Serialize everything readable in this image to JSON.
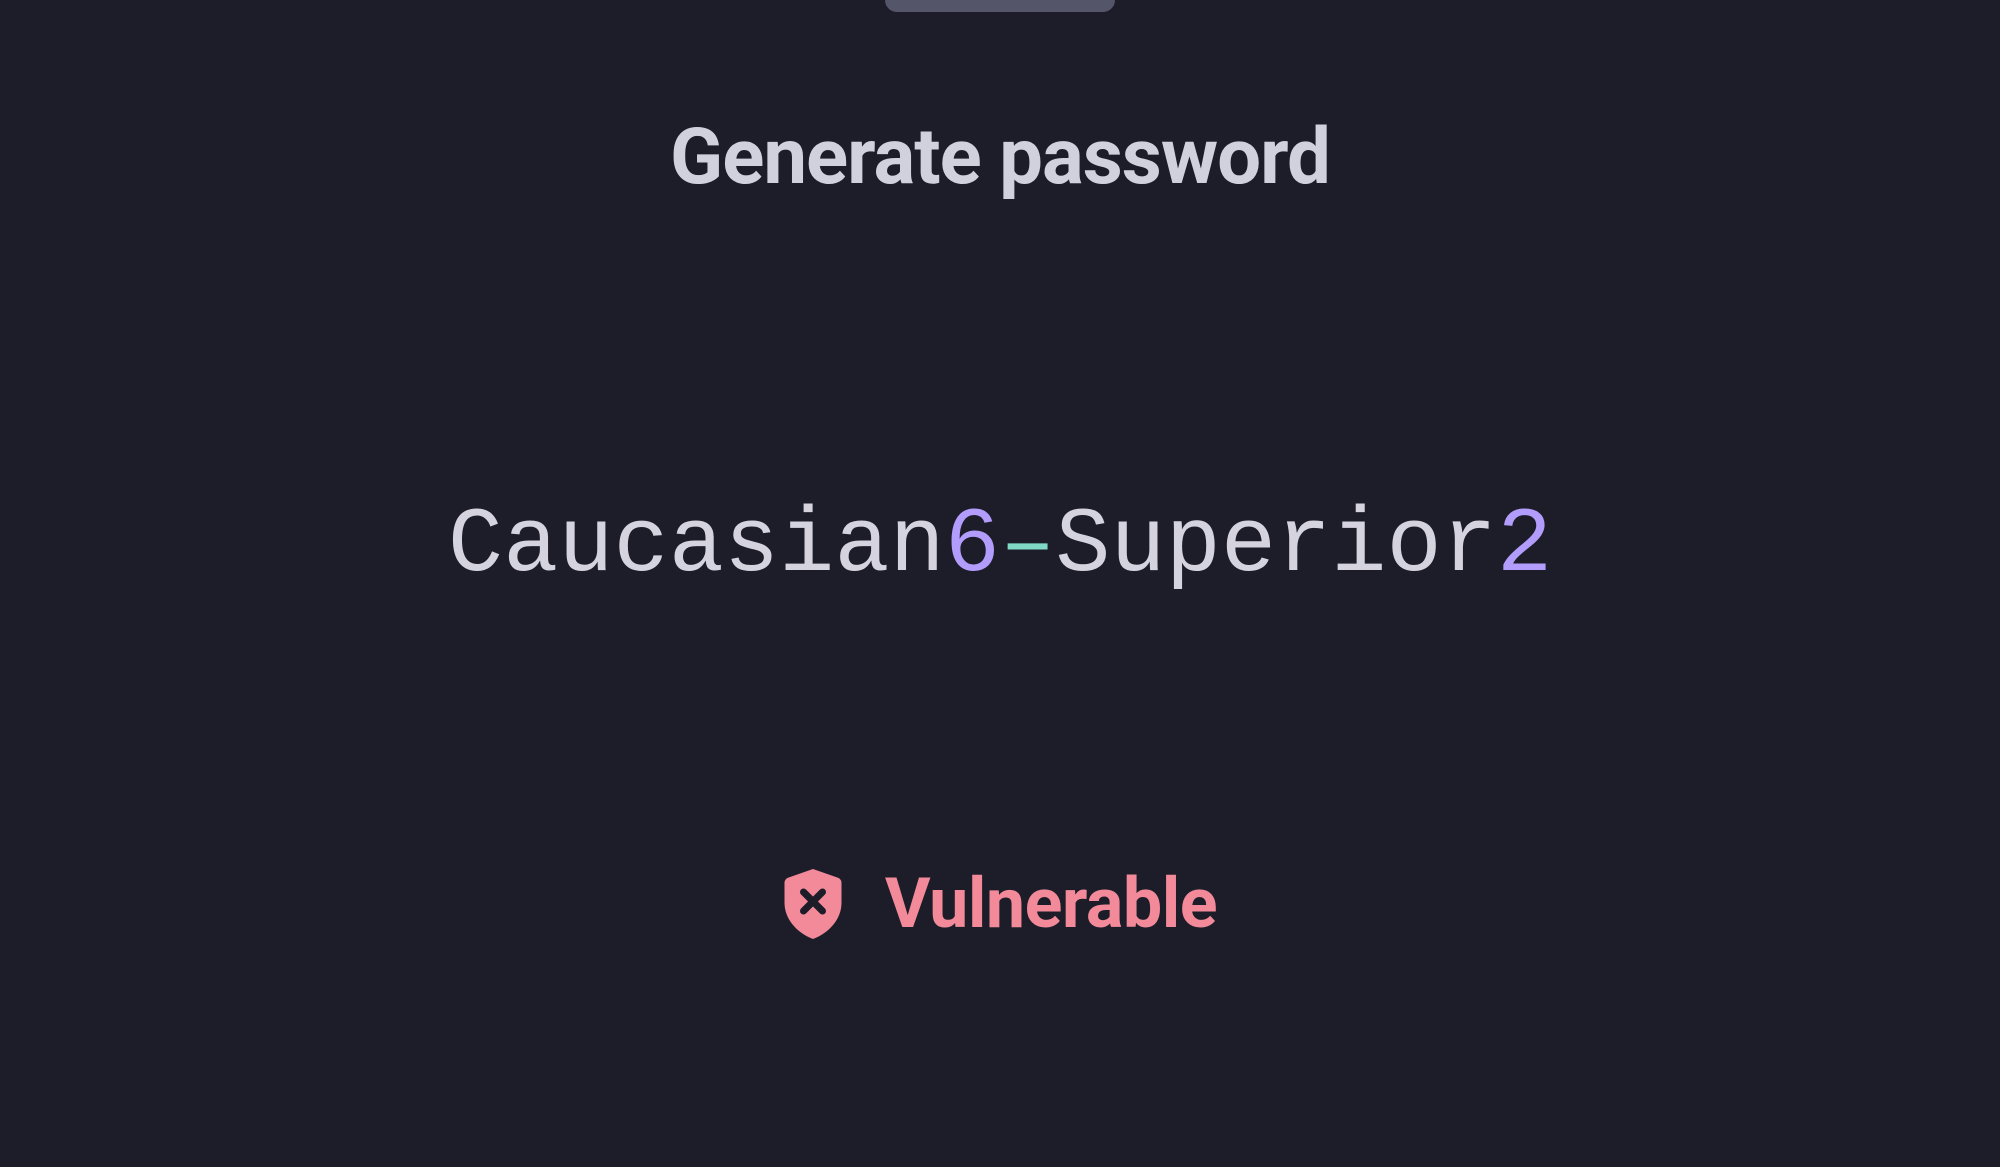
{
  "header": {
    "title": "Generate password"
  },
  "password": {
    "segments": [
      {
        "text": "Caucasian",
        "type": "letter"
      },
      {
        "text": "6",
        "type": "digit"
      },
      {
        "text": "–",
        "type": "symbol"
      },
      {
        "text": "Superior",
        "type": "letter"
      },
      {
        "text": "2",
        "type": "digit"
      }
    ]
  },
  "strength": {
    "label": "Vulnerable",
    "icon": "shield-x-icon",
    "color": "#f38a99"
  }
}
